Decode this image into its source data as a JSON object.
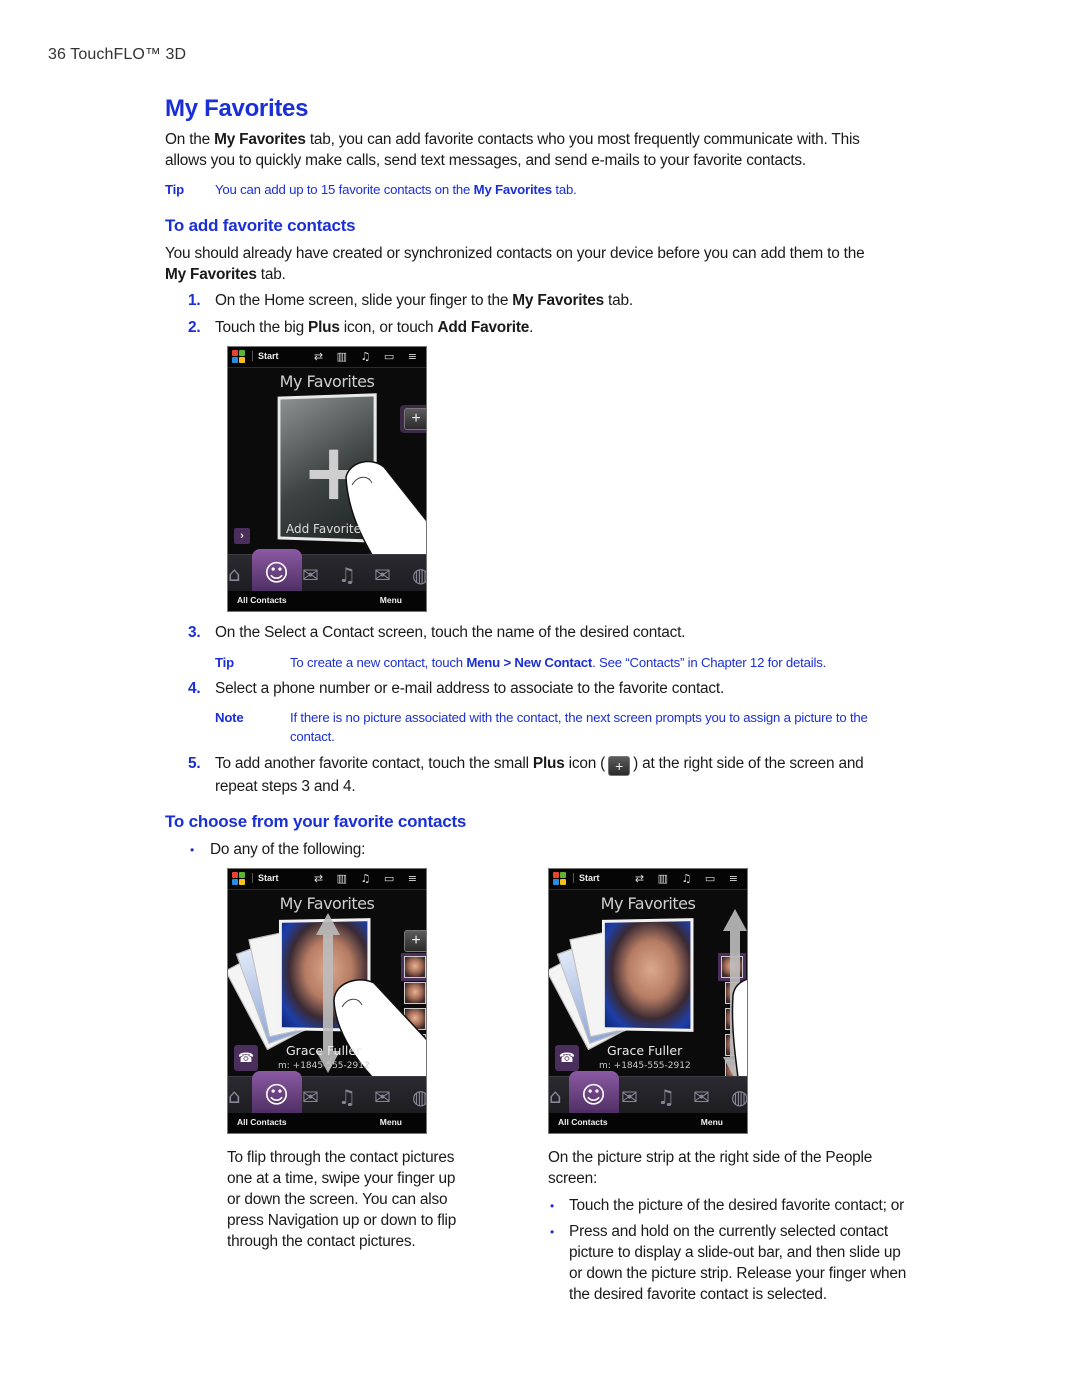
{
  "running_head": "36  TouchFLO™ 3D",
  "title": "My Favorites",
  "intro": {
    "p1_pre": "On the ",
    "p1_bold": "My Favorites",
    "p1_post": " tab, you can add favorite contacts who you most frequently communicate with. This",
    "p2": "allows you to quickly make calls, send text messages, and send e-mails to your favorite contacts."
  },
  "tip1": {
    "label": "Tip",
    "pre": "You can add up to 15 favorite contacts on the ",
    "bold": "My Favorites",
    "post": " tab."
  },
  "section_add": {
    "heading": "To add favorite contacts",
    "para_l1": "You should already have created or synchronized contacts on your device before you can add them to the",
    "para_l2_bold": "My Favorites",
    "para_l2_post": " tab.",
    "steps": [
      {
        "num": "1.",
        "pre": "On the Home screen, slide your finger to the ",
        "bold": "My Favorites",
        "post": " tab."
      },
      {
        "num": "2.",
        "pre": "Touch the big ",
        "bold": "Plus",
        "mid": " icon, or touch ",
        "bold2": "Add Favorite",
        "post": "."
      },
      {
        "num": "3.",
        "text": "On the Select a Contact screen, touch the name of the desired contact."
      },
      {
        "num": "4.",
        "text": "Select a phone number or e-mail address to associate to the favorite contact."
      },
      {
        "num": "5.",
        "pre": "To add another favorite contact, touch the small ",
        "bold": "Plus",
        "mid": " icon (",
        "post": ") at the right side of the screen and",
        "line2": "repeat steps 3 and 4."
      }
    ],
    "tip2": {
      "label": "Tip",
      "pre": "To create a new contact, touch ",
      "bold": "Menu > New Contact",
      "post": ". See “Contacts” in Chapter 12 for details."
    },
    "note": {
      "label": "Note",
      "l1": "If there is no picture associated with the contact, the next screen prompts you to assign a picture to the",
      "l2": "contact."
    }
  },
  "section_choose": {
    "heading": "To choose from your favorite contacts",
    "bullet": "Do any of the following:",
    "left_col": [
      "To flip through the contact pictures",
      "one at a time, swipe your finger up",
      "or down the screen. You can also",
      "press Navigation up or down to flip",
      "through the contact pictures."
    ],
    "right_col_intro": [
      "On the picture strip at the right side of the People",
      "screen:"
    ],
    "right_bullets": [
      [
        "Touch the picture of the desired favorite contact; or"
      ],
      [
        "Press and hold on the currently selected contact",
        "picture to display a slide-out bar, and then slide up",
        "or down the picture strip. Release your finger when",
        "the desired favorite contact is selected."
      ]
    ]
  },
  "phone": {
    "start": "Start",
    "status_icons": "⇄ ▥ ♫ ▭ ≡",
    "screen_title": "My Favorites",
    "add_favorite": "Add Favorite",
    "soft_left": "All Contacts",
    "soft_right": "Menu",
    "contact_name": "Grace Fuller",
    "contact_number": "m: +1845-555-2912",
    "plus": "+",
    "chevron": "›",
    "phone_glyph": "☎",
    "tabs": [
      "⌂",
      "☺",
      "✉",
      "♫",
      "✉",
      "◍"
    ]
  },
  "colors": {
    "heading_blue": "#1b2fd6",
    "tab_purple": "#7a4a93"
  }
}
